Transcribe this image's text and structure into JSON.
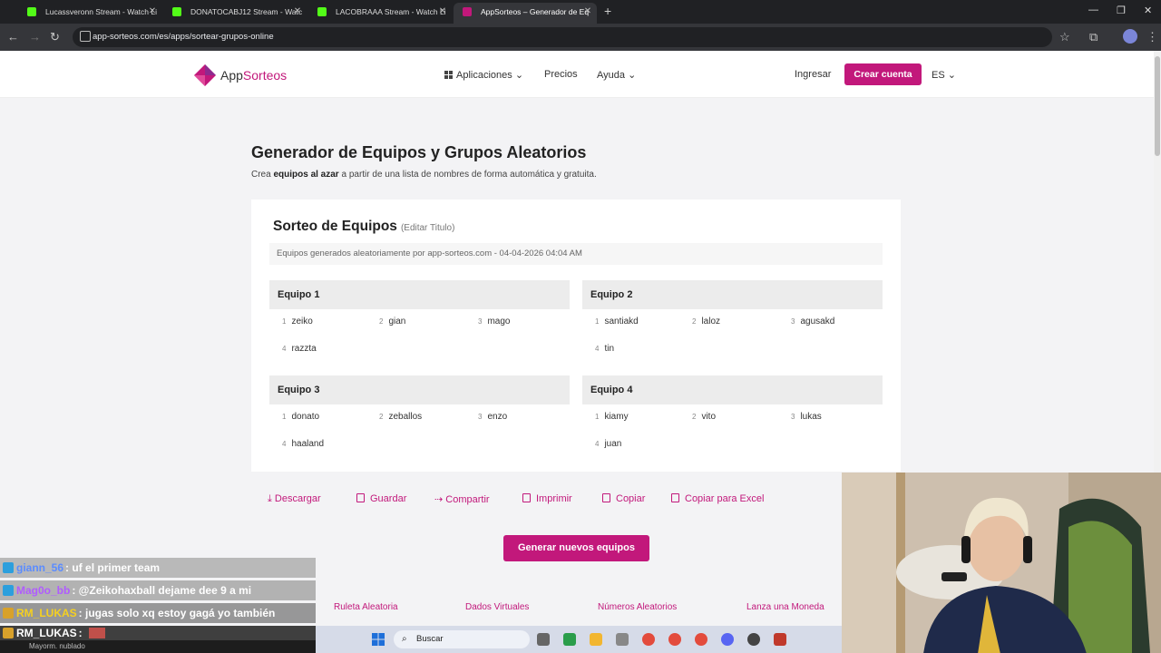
{
  "browser": {
    "tabs": [
      {
        "title": "Lucassveronn Stream - Watch Li"
      },
      {
        "title": "DONATOCABJ12 Stream - Watc"
      },
      {
        "title": "LACOBRAAA Stream - Watch Li"
      },
      {
        "title": "AppSorteos – Generador de Eq",
        "active": true
      }
    ],
    "url": "app-sorteos.com/es/apps/sortear-grupos-online"
  },
  "site": {
    "logo": {
      "pre": "App",
      "post": "Sorteos"
    },
    "nav": {
      "apps": "Aplicaciones",
      "pricing": "Precios",
      "help": "Ayuda"
    },
    "login": "Ingresar",
    "signup": "Crear cuenta",
    "lang": "ES",
    "brand_color": "#c2187b"
  },
  "page": {
    "title": "Generador de Equipos y Grupos Aleatorios",
    "subtitle_pre": "Crea ",
    "subtitle_bold": "equipos al azar",
    "subtitle_post": " a partir de una lista de nombres de forma automática y gratuita."
  },
  "card": {
    "title": "Sorteo de Equipos",
    "edit": "(Editar Titulo)",
    "meta": "Equipos generados aleatoriamente por app-sorteos.com - 04-04-2026 04:04 AM",
    "teams": [
      {
        "name": "Equipo 1",
        "members": [
          "zeiko",
          "gian",
          "mago",
          "razzta"
        ]
      },
      {
        "name": "Equipo 2",
        "members": [
          "santiakd",
          "laloz",
          "agusakd",
          "tin"
        ]
      },
      {
        "name": "Equipo 3",
        "members": [
          "donato",
          "zeballos",
          "enzo",
          "haaland"
        ]
      },
      {
        "name": "Equipo 4",
        "members": [
          "kiamy",
          "vito",
          "lukas",
          "juan"
        ]
      }
    ],
    "numbers": [
      "1",
      "2",
      "3",
      "4"
    ]
  },
  "actions": {
    "download": "Descargar",
    "save": "Guardar",
    "share": "Compartir",
    "print": "Imprimir",
    "copy": "Copiar",
    "excel": "Copiar para Excel"
  },
  "generate": "Generar nuevos equipos",
  "footer": [
    "Ruleta Aleatoria",
    "Dados Virtuales",
    "Números Aleatorios",
    "Lanza una Moneda"
  ],
  "chat": [
    {
      "user": "giann_56",
      "msg": ": uf el primer team",
      "color": "#5b8cff"
    },
    {
      "user": "Mag0o_bb",
      "msg": ": @Zeikohaxball dejame dee 9 a mi",
      "color": "#b05cff"
    },
    {
      "user": "RM_LUKAS",
      "msg": ": jugas solo xq estoy gagá yo también",
      "color": "#f5d020"
    },
    {
      "user": "RM_LUKAS",
      "msg": ":",
      "color": "#ffffff"
    }
  ],
  "weather": "Mayorm. nublado",
  "taskbar": {
    "search": "Buscar"
  }
}
